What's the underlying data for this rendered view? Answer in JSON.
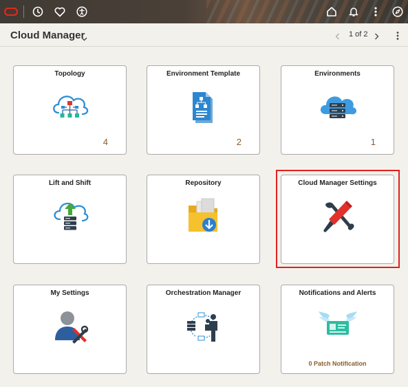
{
  "header": {
    "icons": [
      "oracle-logo-icon",
      "history-icon",
      "favorites-icon",
      "accessibility-icon",
      "home-icon",
      "notifications-icon",
      "actions-icon",
      "navigator-icon"
    ]
  },
  "subheader": {
    "title": "Cloud Manager",
    "pager_text": "1 of 2"
  },
  "tiles": [
    {
      "title": "Topology",
      "count": "4",
      "icon": "topology-icon"
    },
    {
      "title": "Environment Template",
      "count": "2",
      "icon": "document-icon"
    },
    {
      "title": "Environments",
      "count": "1",
      "icon": "cloud-server-icon"
    },
    {
      "title": "Lift and Shift",
      "count": "",
      "icon": "cloud-upload-icon"
    },
    {
      "title": "Repository",
      "count": "",
      "icon": "folder-download-icon"
    },
    {
      "title": "Cloud Manager Settings",
      "count": "",
      "icon": "tools-icon"
    },
    {
      "title": "My Settings",
      "count": "",
      "icon": "user-settings-icon"
    },
    {
      "title": "Orchestration Manager",
      "count": "",
      "icon": "orchestration-icon"
    },
    {
      "title": "Notifications and Alerts",
      "footer": "0  Patch Notification",
      "icon": "notification-ticket-icon"
    }
  ],
  "colors": {
    "accent_count": "#8a5a2b",
    "highlight": "#e0201d",
    "cloud_blue": "#2b8fd6"
  }
}
